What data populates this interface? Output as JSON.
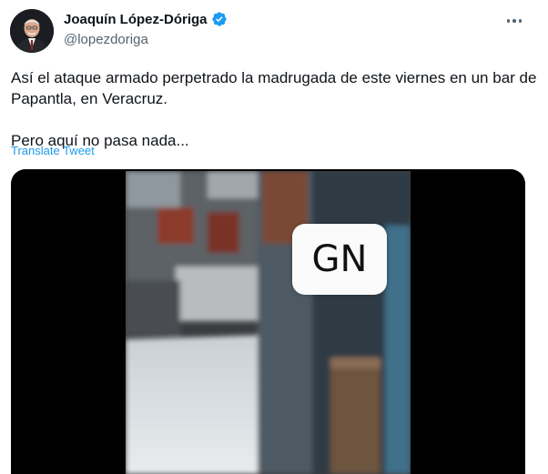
{
  "author": {
    "display_name": "Joaquín López-Dóriga",
    "handle": "@lopezdoriga",
    "verified": true
  },
  "tweet": {
    "paragraphs": [
      "Así el ataque armado perpetrado la madrugada de este viernes en un bar de Papantla, en Veracruz.",
      "Pero aquí no pasa nada..."
    ],
    "translate_label": "Translate Tweet"
  },
  "media": {
    "overlay_text": "GN"
  },
  "icons": {
    "verified": "verified-badge-icon",
    "more": "more-options-icon"
  },
  "colors": {
    "link": "#1d9bf0",
    "secondary_text": "#536471",
    "primary_text": "#0f1419"
  }
}
